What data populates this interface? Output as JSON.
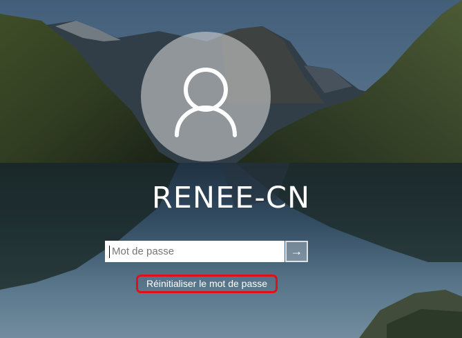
{
  "login": {
    "username": "RENEE-CN",
    "password_placeholder": "Mot de passe",
    "reset_link": "Réinitialiser le mot de passe"
  },
  "icons": {
    "submit": "arrow-right-icon",
    "avatar": "user-silhouette-icon"
  },
  "colors": {
    "highlight_border": "#e0101a",
    "text": "#ffffff"
  }
}
